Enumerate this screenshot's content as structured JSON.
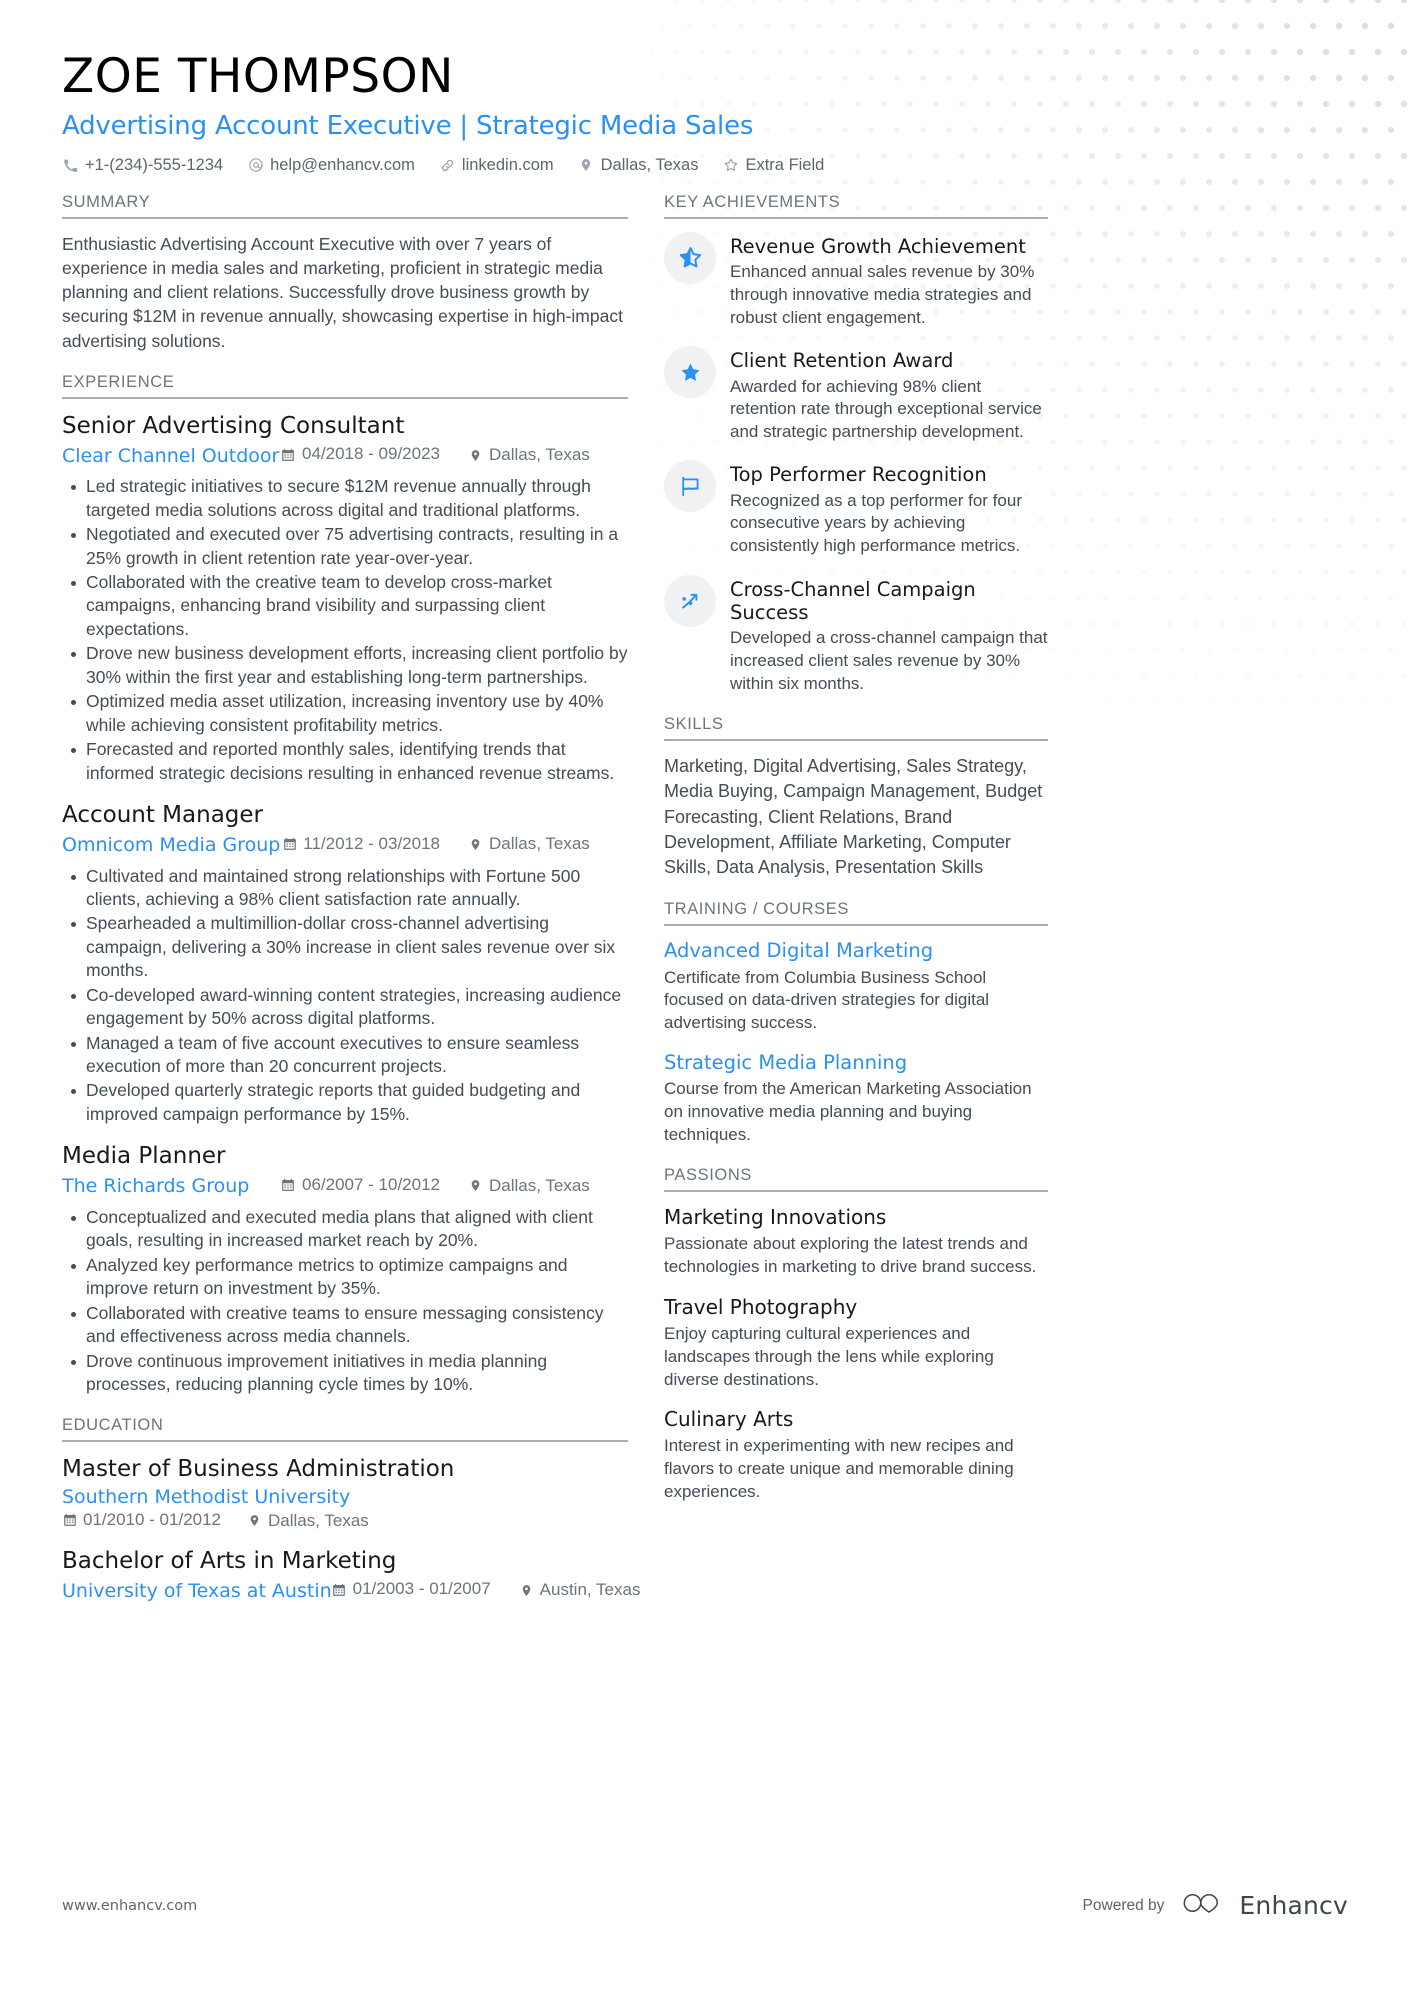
{
  "header": {
    "name": "ZOE THOMPSON",
    "headline": "Advertising Account Executive | Strategic Media Sales",
    "contacts": [
      {
        "icon": "phone-icon",
        "text": "+1-(234)-555-1234"
      },
      {
        "icon": "email-icon",
        "text": "help@enhancv.com"
      },
      {
        "icon": "link-icon",
        "text": "linkedin.com"
      },
      {
        "icon": "location-pin-icon",
        "text": "Dallas, Texas"
      },
      {
        "icon": "star-outline-icon",
        "text": "Extra Field"
      }
    ]
  },
  "summary": {
    "heading": "SUMMARY",
    "text": "Enthusiastic Advertising Account Executive with over 7 years of experience in media sales and marketing, proficient in strategic media planning and client relations. Successfully drove business growth by securing $12M in revenue annually, showcasing expertise in high-impact advertising solutions."
  },
  "experience": {
    "heading": "EXPERIENCE",
    "entries": [
      {
        "title": "Senior Advertising Consultant",
        "org": "Clear Channel Outdoor",
        "date": "04/2018 - 09/2023",
        "location": "Dallas, Texas",
        "bullets": [
          "Led strategic initiatives to secure $12M revenue annually through targeted media solutions across digital and traditional platforms.",
          "Negotiated and executed over 75 advertising contracts, resulting in a 25% growth in client retention rate year-over-year.",
          "Collaborated with the creative team to develop cross-market campaigns, enhancing brand visibility and surpassing client expectations.",
          "Drove new business development efforts, increasing client portfolio by 30% within the first year and establishing long-term partnerships.",
          "Optimized media asset utilization, increasing inventory use by 40% while achieving consistent profitability metrics.",
          "Forecasted and reported monthly sales, identifying trends that informed strategic decisions resulting in enhanced revenue streams."
        ]
      },
      {
        "title": "Account Manager",
        "org": "Omnicom Media Group",
        "date": "11/2012 - 03/2018",
        "location": "Dallas, Texas",
        "bullets": [
          "Cultivated and maintained strong relationships with Fortune 500 clients, achieving a 98% client satisfaction rate annually.",
          "Spearheaded a multimillion-dollar cross-channel advertising campaign, delivering a 30% increase in client sales revenue over six months.",
          "Co-developed award-winning content strategies, increasing audience engagement by 50% across digital platforms.",
          "Managed a team of five account executives to ensure seamless execution of more than 20 concurrent projects.",
          "Developed quarterly strategic reports that guided budgeting and improved campaign performance by 15%."
        ]
      },
      {
        "title": "Media Planner",
        "org": "The Richards Group",
        "date": "06/2007 - 10/2012",
        "location": "Dallas, Texas",
        "bullets": [
          "Conceptualized and executed media plans that aligned with client goals, resulting in increased market reach by 20%.",
          "Analyzed key performance metrics to optimize campaigns and improve return on investment by 35%.",
          "Collaborated with creative teams to ensure messaging consistency and effectiveness across media channels.",
          "Drove continuous improvement initiatives in media planning processes, reducing planning cycle times by 10%."
        ]
      }
    ]
  },
  "education": {
    "heading": "EDUCATION",
    "entries": [
      {
        "title": "Master of Business Administration",
        "org": "Southern Methodist University",
        "date": "01/2010 - 01/2012",
        "location": "Dallas, Texas",
        "inline": false
      },
      {
        "title": "Bachelor of Arts in Marketing",
        "org": "University of Texas at Austin",
        "date": "01/2003 - 01/2007",
        "location": "Austin, Texas",
        "inline": true
      }
    ]
  },
  "achievements": {
    "heading": "KEY ACHIEVEMENTS",
    "items": [
      {
        "icon": "star-outline-icon",
        "title": "Revenue Growth Achievement",
        "desc": "Enhanced annual sales revenue by 30% through innovative media strategies and robust client engagement."
      },
      {
        "icon": "star-filled-icon",
        "title": "Client Retention Award",
        "desc": "Awarded for achieving 98% client retention rate through exceptional service and strategic partnership development."
      },
      {
        "icon": "flag-icon",
        "title": "Top Performer Recognition",
        "desc": "Recognized as a top performer for four consecutive years by achieving consistently high performance metrics."
      },
      {
        "icon": "trending-arrow-icon",
        "title": "Cross-Channel Campaign Success",
        "desc": "Developed a cross-channel campaign that increased client sales revenue by 30% within six months."
      }
    ]
  },
  "skills": {
    "heading": "SKILLS",
    "text": "Marketing, Digital Advertising, Sales Strategy, Media Buying, Campaign Management, Budget Forecasting, Client Relations, Brand Development, Affiliate Marketing, Computer Skills, Data Analysis, Presentation Skills"
  },
  "training": {
    "heading": "TRAINING / COURSES",
    "items": [
      {
        "title": "Advanced Digital Marketing",
        "desc": "Certificate from Columbia Business School focused on data-driven strategies for digital advertising success."
      },
      {
        "title": "Strategic Media Planning",
        "desc": "Course from the American Marketing Association on innovative media planning and buying techniques."
      }
    ]
  },
  "passions": {
    "heading": "PASSIONS",
    "items": [
      {
        "title": "Marketing Innovations",
        "desc": "Passionate about exploring the latest trends and technologies in marketing to drive brand success."
      },
      {
        "title": "Travel Photography",
        "desc": "Enjoy capturing cultural experiences and landscapes through the lens while exploring diverse destinations."
      },
      {
        "title": "Culinary Arts",
        "desc": "Interest in experimenting with new recipes and flavors to create unique and memorable dining experiences."
      }
    ]
  },
  "footer": {
    "url": "www.enhancv.com",
    "powered_by": "Powered by",
    "brand": "Enhancv"
  },
  "colors": {
    "accent_blue": "#2a90f5",
    "heading_gray": "#6b757d",
    "body_gray": "#434d56",
    "badge_bg": "#f0f1f2"
  }
}
